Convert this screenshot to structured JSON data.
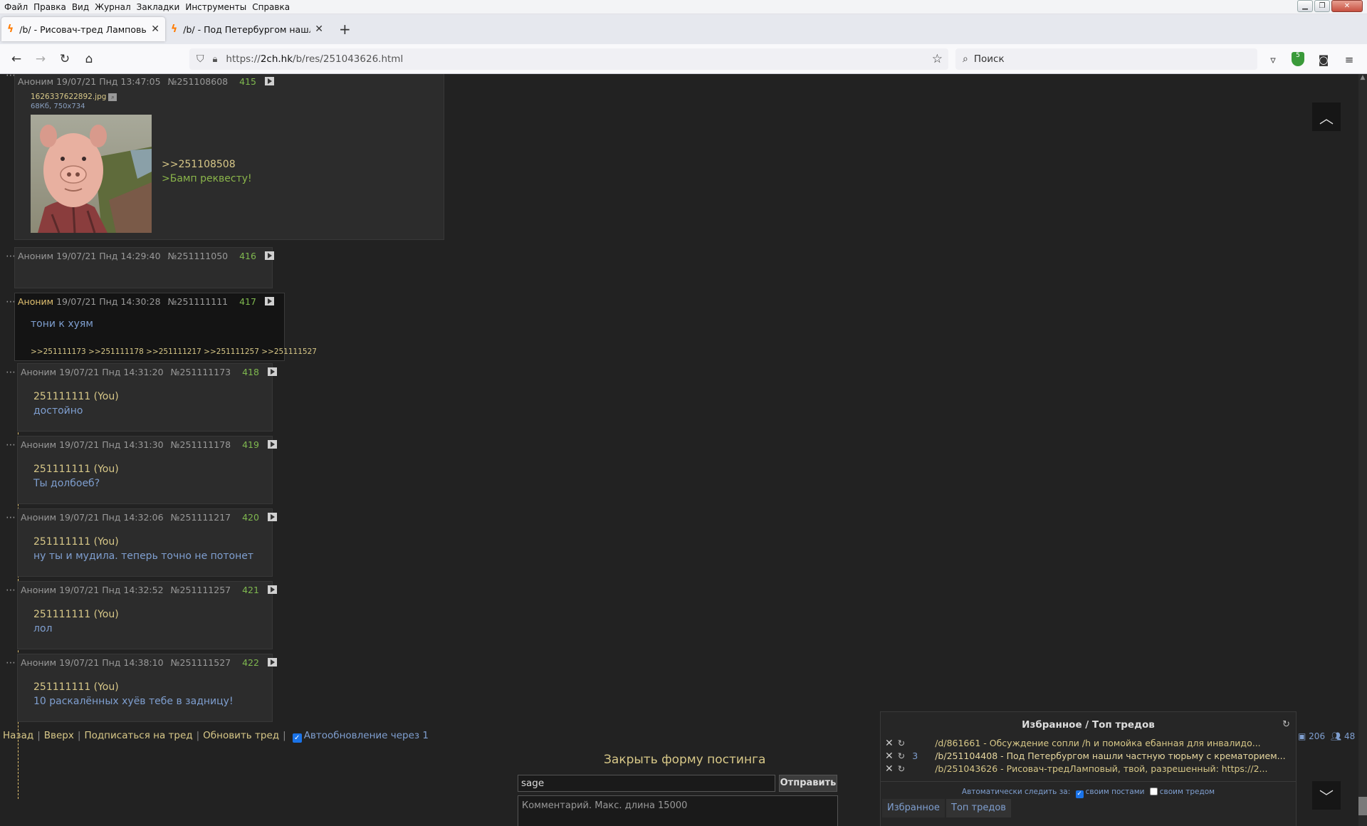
{
  "menu": [
    "Файл",
    "Правка",
    "Вид",
    "Журнал",
    "Закладки",
    "Инструменты",
    "Справка"
  ],
  "tabs": [
    {
      "label": "/b/ - Рисовач-тред Ламповый",
      "active": true
    },
    {
      "label": "/b/ - Под Петербургом нашли",
      "active": false
    }
  ],
  "url": {
    "prefix": "https://",
    "host": "2ch.hk",
    "path": "/b/res/251043626.html"
  },
  "search": {
    "placeholder": "Поиск"
  },
  "toolbar": {
    "ublock_badge": "5"
  },
  "posts": [
    {
      "author": "Аноним",
      "date": "19/07/21 Пнд 13:47:05",
      "num": "№251108608",
      "count": "415",
      "file": {
        "name": "1626337622892.jpg",
        "info": "68Кб, 750x734"
      },
      "reply": ">>251108508",
      "msg": ">Бамп реквесту!"
    },
    {
      "author": "Аноним",
      "date": "19/07/21 Пнд 14:29:40",
      "num": "№251111050",
      "count": "416"
    },
    {
      "author": "Аноним",
      "date": "19/07/21 Пнд 14:30:28",
      "num": "№251111111",
      "count": "417",
      "msg": "тони к хуям",
      "refs": ">>251111173 >>251111178 >>251111217 >>251111257 >>251111527"
    },
    {
      "author": "Аноним",
      "date": "19/07/21 Пнд 14:31:20",
      "num": "№251111173",
      "count": "418",
      "reply": "251111111 (You)",
      "msg": "достойно"
    },
    {
      "author": "Аноним",
      "date": "19/07/21 Пнд 14:31:30",
      "num": "№251111178",
      "count": "419",
      "reply": "251111111 (You)",
      "msg": "Ты долбоеб?"
    },
    {
      "author": "Аноним",
      "date": "19/07/21 Пнд 14:32:06",
      "num": "№251111217",
      "count": "420",
      "reply": "251111111 (You)",
      "msg": "ну ты и мудила. теперь точно не потонет"
    },
    {
      "author": "Аноним",
      "date": "19/07/21 Пнд 14:32:52",
      "num": "№251111257",
      "count": "421",
      "reply": "251111111 (You)",
      "msg": "лол"
    },
    {
      "author": "Аноним",
      "date": "19/07/21 Пнд 14:38:10",
      "num": "№251111527",
      "count": "422",
      "reply": "251111111 (You)",
      "msg": "10 раскалённых хуёв тебе в задницу!"
    }
  ],
  "bottom_nav": {
    "back": "Назад",
    "up": "Вверх",
    "subscribe": "Подписаться на тред",
    "refresh": "Обновить тред",
    "auto": "Автообновление через 1"
  },
  "form": {
    "close": "Закрыть форму постинга",
    "email": "sage",
    "submit": "Отправить",
    "comment_placeholder": "Комментарий. Макс. длина 15000"
  },
  "favorites": {
    "title": "Избранное / Топ тредов",
    "rows": [
      {
        "count": "",
        "text": "/d/861661 - Обсуждение сопли /h и помойка ебанная для инвалидо..."
      },
      {
        "count": "3",
        "text": "/b/251104408 - Под Петербургом нашли частную тюрьму с крематорием..."
      },
      {
        "count": "",
        "text": "/b/251043626 - Рисовач-тредЛамповый, твой, разрешенный: https://2..."
      }
    ],
    "auto_label": "Автоматически следить за:",
    "own_posts": "своим постами",
    "own_thread": "своим тредом",
    "tab_fav": "Избранное",
    "tab_top": "Топ тредов"
  },
  "stats": {
    "images": "206",
    "users": "48"
  }
}
